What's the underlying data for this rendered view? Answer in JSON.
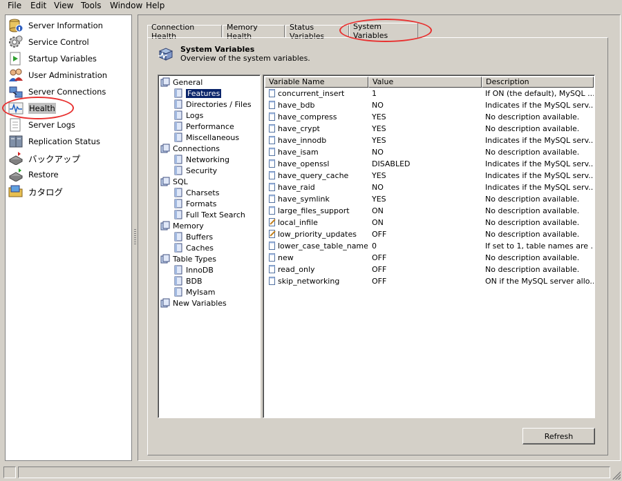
{
  "menu": [
    "File",
    "Edit",
    "View",
    "Tools",
    "Window",
    "Help"
  ],
  "sidebar": {
    "items": [
      {
        "label": "Server Information",
        "icon": "database-icon"
      },
      {
        "label": "Service Control",
        "icon": "gears-icon"
      },
      {
        "label": "Startup Variables",
        "icon": "startup-icon"
      },
      {
        "label": "User Administration",
        "icon": "users-icon"
      },
      {
        "label": "Server Connections",
        "icon": "connections-icon"
      },
      {
        "label": "Health",
        "icon": "health-icon",
        "selected": true
      },
      {
        "label": "Server Logs",
        "icon": "logs-icon"
      },
      {
        "label": "Replication Status",
        "icon": "replication-icon"
      },
      {
        "label": "バックアップ",
        "icon": "backup-icon"
      },
      {
        "label": "Restore",
        "icon": "restore-icon"
      },
      {
        "label": "カタログ",
        "icon": "catalog-icon"
      }
    ]
  },
  "tabs": [
    {
      "label": "Connection Health"
    },
    {
      "label": "Memory Health"
    },
    {
      "label": "Status Variables"
    },
    {
      "label": "System Variables",
      "active": true
    }
  ],
  "panel": {
    "title": "System Variables",
    "subtitle": "Overview of the system variables."
  },
  "tree": [
    {
      "label": "General",
      "level": 0
    },
    {
      "label": "Features",
      "level": 1,
      "selected": true
    },
    {
      "label": "Directories / Files",
      "level": 1
    },
    {
      "label": "Logs",
      "level": 1
    },
    {
      "label": "Performance",
      "level": 1
    },
    {
      "label": "Miscellaneous",
      "level": 1
    },
    {
      "label": "Connections",
      "level": 0
    },
    {
      "label": "Networking",
      "level": 1
    },
    {
      "label": "Security",
      "level": 1
    },
    {
      "label": "SQL",
      "level": 0
    },
    {
      "label": "Charsets",
      "level": 1
    },
    {
      "label": "Formats",
      "level": 1
    },
    {
      "label": "Full Text Search",
      "level": 1
    },
    {
      "label": "Memory",
      "level": 0
    },
    {
      "label": "Buffers",
      "level": 1
    },
    {
      "label": "Caches",
      "level": 1
    },
    {
      "label": "Table Types",
      "level": 0
    },
    {
      "label": "InnoDB",
      "level": 1
    },
    {
      "label": "BDB",
      "level": 1
    },
    {
      "label": "MyIsam",
      "level": 1
    },
    {
      "label": "New Variables",
      "level": 0
    }
  ],
  "grid": {
    "columns": [
      "Variable Name",
      "Value",
      "Description"
    ],
    "rows": [
      {
        "name": "concurrent_insert",
        "value": "1",
        "desc": "If ON (the default), MySQL ...",
        "editable": false
      },
      {
        "name": "have_bdb",
        "value": "NO",
        "desc": "Indicates if the MySQL serv...",
        "editable": false
      },
      {
        "name": "have_compress",
        "value": "YES",
        "desc": "No description available.",
        "editable": false
      },
      {
        "name": "have_crypt",
        "value": "YES",
        "desc": "No description available.",
        "editable": false
      },
      {
        "name": "have_innodb",
        "value": "YES",
        "desc": "Indicates if the MySQL serv...",
        "editable": false
      },
      {
        "name": "have_isam",
        "value": "NO",
        "desc": "No description available.",
        "editable": false
      },
      {
        "name": "have_openssl",
        "value": "DISABLED",
        "desc": "Indicates if the MySQL serv...",
        "editable": false
      },
      {
        "name": "have_query_cache",
        "value": "YES",
        "desc": "Indicates if the MySQL serv...",
        "editable": false
      },
      {
        "name": "have_raid",
        "value": "NO",
        "desc": "Indicates if the MySQL serv...",
        "editable": false
      },
      {
        "name": "have_symlink",
        "value": "YES",
        "desc": "No description available.",
        "editable": false
      },
      {
        "name": "large_files_support",
        "value": "ON",
        "desc": "No description available.",
        "editable": false
      },
      {
        "name": "local_infile",
        "value": "ON",
        "desc": "No description available.",
        "editable": true
      },
      {
        "name": "low_priority_updates",
        "value": "OFF",
        "desc": "No description available.",
        "editable": true
      },
      {
        "name": "lower_case_table_names",
        "value": "0",
        "desc": "If set to 1, table names are ...",
        "editable": false
      },
      {
        "name": "new",
        "value": "OFF",
        "desc": "No description available.",
        "editable": false
      },
      {
        "name": "read_only",
        "value": "OFF",
        "desc": "No description available.",
        "editable": false
      },
      {
        "name": "skip_networking",
        "value": "OFF",
        "desc": "ON if the MySQL server allo...",
        "editable": false
      }
    ]
  },
  "buttons": {
    "refresh": "Refresh"
  },
  "colors": {
    "highlight": "#e8302f",
    "selection": "#0a246a",
    "chrome": "#d4d0c8"
  }
}
